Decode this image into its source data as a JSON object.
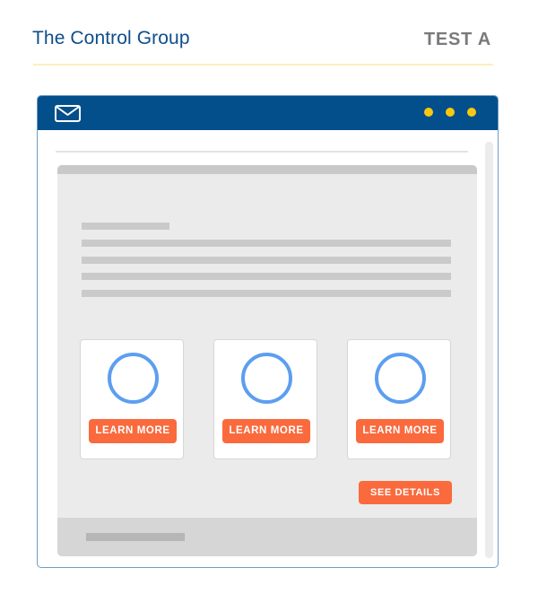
{
  "header": {
    "title": "The Control Group",
    "variant_label": "TEST A"
  },
  "window": {
    "icon": "envelope-icon",
    "menu_dots": 3,
    "colors": {
      "title_bar": "#024f8b",
      "dots": "#f9c80e",
      "button": "#fa6a3d",
      "circle": "#5c9ef1"
    }
  },
  "email": {
    "cards": [
      {
        "icon": "circle-icon",
        "button_label": "LEARN MORE"
      },
      {
        "icon": "circle-icon",
        "button_label": "LEARN MORE"
      },
      {
        "icon": "circle-icon",
        "button_label": "LEARN MORE"
      }
    ],
    "cta_label": "SEE DETAILS"
  }
}
